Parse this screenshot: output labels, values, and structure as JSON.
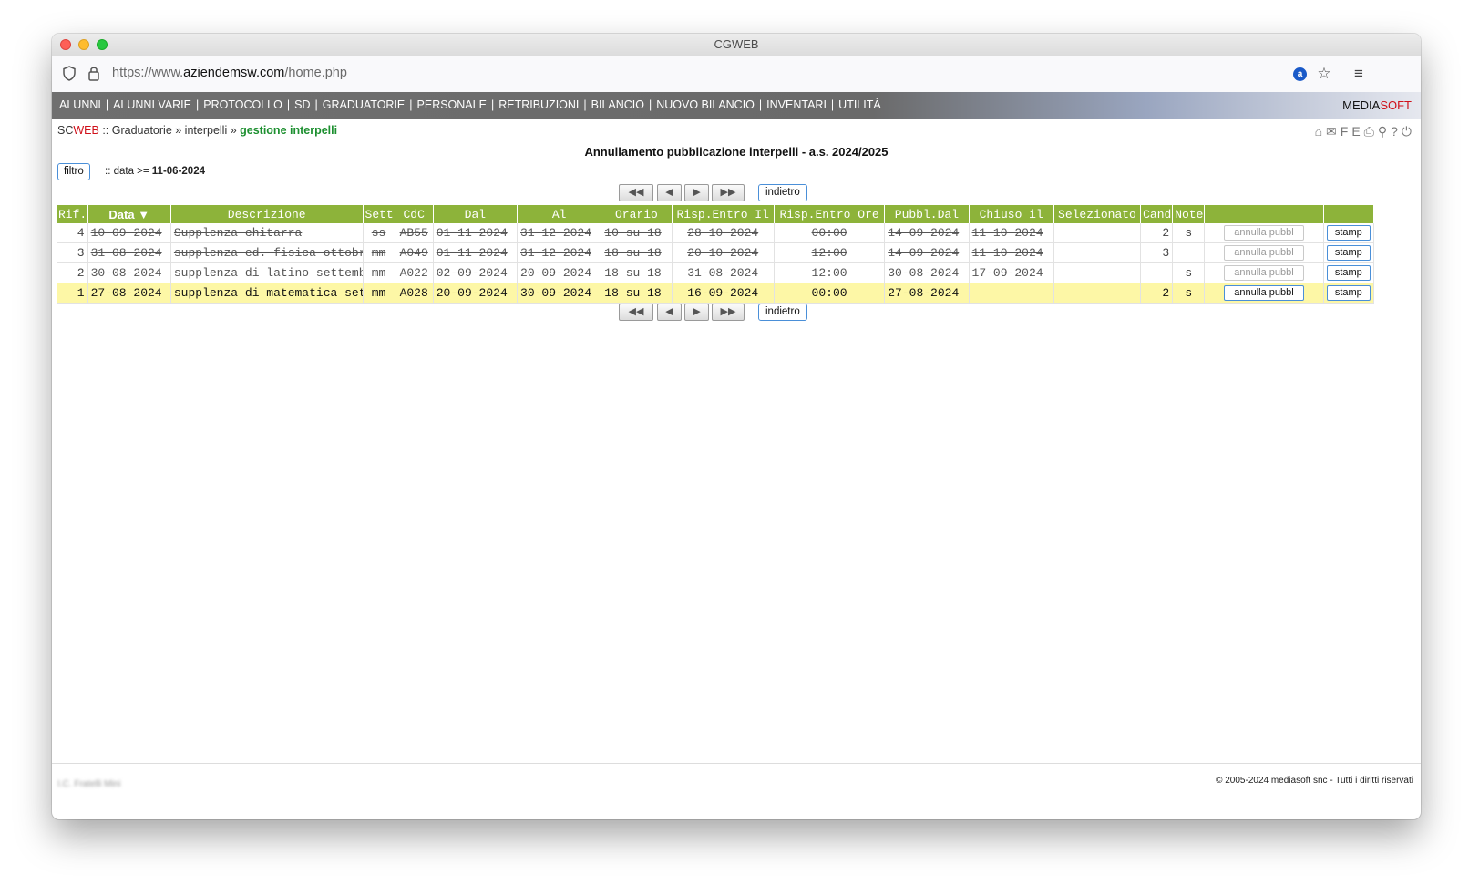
{
  "window": {
    "title": "CGWEB"
  },
  "browser": {
    "url_prefix": "https://www.",
    "url_domain": "aziendemsw.com",
    "url_path": "/home.php"
  },
  "menu": [
    "ALUNNI",
    "ALUNNI VARIE",
    "PROTOCOLLO",
    "SD",
    "GRADUATORIE",
    "PERSONALE",
    "RETRIBUZIONI",
    "BILANCIO",
    "NUOVO BILANCIO",
    "INVENTARI",
    "UTILITÀ"
  ],
  "brand": {
    "media": "MEDIA",
    "soft": "SOFT"
  },
  "breadcrumb": {
    "sc": "SC",
    "web": "WEB",
    "sep": " :: ",
    "path": "Graduatorie » interpelli » ",
    "current": "gestione interpelli"
  },
  "toolbar_icons": [
    "home-icon",
    "mail-icon",
    "fe-label",
    "print-icon",
    "search-icon",
    "help-icon",
    "power-icon"
  ],
  "toolbar_fe": "FE",
  "page_title": "Annullamento pubblicazione interpelli - a.s. 2024/2025",
  "filter": {
    "button": "filtro",
    "prefix": ":: data >= ",
    "value": "11-06-2024"
  },
  "nav": {
    "first": "◀◀",
    "prev": "◀",
    "next": "▶",
    "last": "▶▶",
    "back": "indietro"
  },
  "table": {
    "headers": [
      "Rif.",
      "Data ▼",
      "Descrizione",
      "Sett",
      "CdC",
      "Dal",
      "Al",
      "Orario",
      "Risp.Entro Il",
      "Risp.Entro Ore",
      "Pubbl.Dal",
      "Chiuso il",
      "Selezionato",
      "Cand",
      "Note",
      "",
      ""
    ],
    "rows": [
      {
        "rif": "4",
        "data": "10-09-2024",
        "descr": "Supplenza chitarra",
        "sett": "ss",
        "cdc": "AB55",
        "dal": "01-11-2024",
        "al": "31-12-2024",
        "orario": "10 su 18",
        "risp_il": "28-10-2024",
        "risp_ore": "00:00",
        "pubbl": "14-09-2024",
        "chiuso": "11-10-2024",
        "sel": "",
        "cand": "2",
        "note": "s",
        "annulla": "annulla pubbl",
        "stamp": "stamp",
        "status": "cancelled"
      },
      {
        "rif": "3",
        "data": "31-08-2024",
        "descr": "supplenza ed. fisica ottobre",
        "sett": "mm",
        "cdc": "A049",
        "dal": "01-11-2024",
        "al": "31-12-2024",
        "orario": "18 su 18",
        "risp_il": "20-10-2024",
        "risp_ore": "12:00",
        "pubbl": "14-09-2024",
        "chiuso": "11-10-2024",
        "sel": "",
        "cand": "3",
        "note": "",
        "annulla": "annulla pubbl",
        "stamp": "stamp",
        "status": "cancelled"
      },
      {
        "rif": "2",
        "data": "30-08-2024",
        "descr": "supplenza di latino settembre",
        "sett": "mm",
        "cdc": "A022",
        "dal": "02-09-2024",
        "al": "20-09-2024",
        "orario": "18 su 18",
        "risp_il": "31-08-2024",
        "risp_ore": "12:00",
        "pubbl": "30-08-2024",
        "chiuso": "17-09-2024",
        "sel": "",
        "cand": "",
        "note": "s",
        "annulla": "annulla pubbl",
        "stamp": "stamp",
        "status": "cancelled"
      },
      {
        "rif": "1",
        "data": "27-08-2024",
        "descr": "supplenza di matematica settembre",
        "sett": "mm",
        "cdc": "A028",
        "dal": "20-09-2024",
        "al": "30-09-2024",
        "orario": "18 su 18",
        "risp_il": "16-09-2024",
        "risp_ore": "00:00",
        "pubbl": "27-08-2024",
        "chiuso": "",
        "sel": "",
        "cand": "2",
        "note": "s",
        "annulla": "annulla pubbl",
        "stamp": "stamp",
        "status": "active"
      }
    ]
  },
  "footer": {
    "left": "I.C. Fratelli Mini",
    "right": "© 2005-2024 mediasoft snc - Tutti i diritti riservati"
  }
}
